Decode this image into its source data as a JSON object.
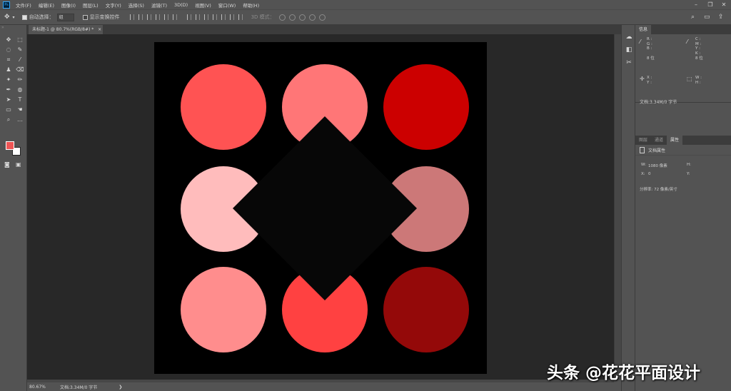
{
  "menu": {
    "items": [
      "文件(F)",
      "编辑(E)",
      "图像(I)",
      "图层(L)",
      "文字(Y)",
      "选择(S)",
      "滤镜(T)",
      "3D(D)",
      "视图(V)",
      "窗口(W)",
      "帮助(H)"
    ]
  },
  "options": {
    "auto_select_label": "自动选择：",
    "auto_select_value": "组",
    "show_transform_label": "显示变换控件",
    "mode3d_label": "3D 模式："
  },
  "tab": {
    "title": "未标题-1 @ 80.7%(RGB/8#) *",
    "close": "×"
  },
  "status": {
    "zoom": "80.67%",
    "doc": "文档:3.34M/0 字节"
  },
  "colors": {
    "foreground": "#ee5555",
    "background": "#ffffff"
  },
  "panels": {
    "top_tabs": [
      "信息"
    ],
    "info": {
      "left_rgb": "R :\nG :\nB :",
      "left_bit": "8 位",
      "right_cmyk": "C :\nM :\nY :\nK :",
      "right_bit": "8 位",
      "xy": "X :\nY :",
      "wh": "W :\nH :",
      "doc": "文档:3.34M/0 字节"
    },
    "bottom_tabs": [
      "图层",
      "通道",
      "属性"
    ],
    "props": {
      "title": "文档属性",
      "w_label": "W:",
      "w_value": "1080 像素",
      "h_label": "H:",
      "x_label": "X:",
      "x_value": "0",
      "y_label": "Y:",
      "resolution": "分辨率: 72 像素/英寸"
    }
  },
  "canvas": {
    "circles": [
      {
        "color": "#ff5353"
      },
      {
        "color": "#ff7677",
        "notch": "bottom"
      },
      {
        "color": "#cc0000"
      },
      {
        "color": "#ffbcbc",
        "notch": "right"
      },
      {
        "color": "#cc7878",
        "notch": "left"
      },
      {
        "color": "#ff8d8d"
      },
      {
        "color": "#ff4141",
        "notch": "top"
      },
      {
        "color": "#940909"
      }
    ],
    "diamond_color": "#070707"
  },
  "watermark": "头条 @花花平面设计"
}
